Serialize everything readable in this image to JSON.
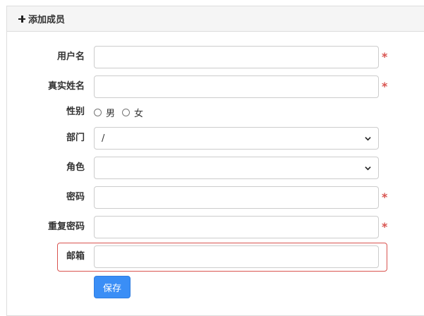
{
  "panel": {
    "title": "添加成员",
    "title_icon": "plus-icon"
  },
  "form": {
    "username": {
      "label": "用户名",
      "value": "",
      "required": true
    },
    "realname": {
      "label": "真实姓名",
      "value": "",
      "required": true
    },
    "gender": {
      "label": "性别",
      "options": [
        {
          "label": "男",
          "checked": false
        },
        {
          "label": "女",
          "checked": false
        }
      ]
    },
    "department": {
      "label": "部门",
      "selected": "/"
    },
    "role": {
      "label": "角色",
      "selected": ""
    },
    "password": {
      "label": "密码",
      "value": "",
      "required": true
    },
    "repeat_password": {
      "label": "重复密码",
      "value": "",
      "required": true
    },
    "email": {
      "label": "邮箱",
      "value": "",
      "state": "error"
    },
    "required_mark": "*",
    "save_label": "保存"
  },
  "colors": {
    "required_star": "#d9534f",
    "error_border": "#d9534f",
    "primary_button": "#3a8ef6",
    "heading_bg": "#f5f5f5"
  }
}
